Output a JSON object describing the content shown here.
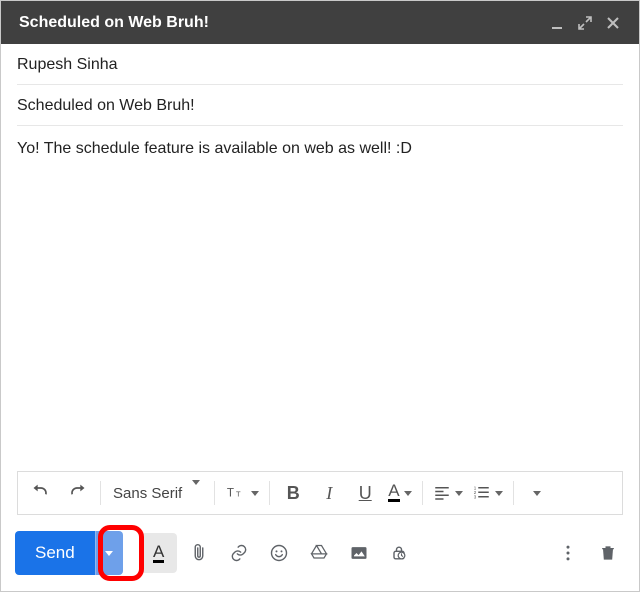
{
  "header": {
    "title": "Scheduled on Web Bruh!"
  },
  "recipients": "Rupesh Sinha",
  "subject": "Scheduled on Web Bruh!",
  "body": "Yo! The schedule feature is available on web as well! :D",
  "format_toolbar": {
    "font_family": "Sans Serif"
  },
  "actions": {
    "send_label": "Send"
  }
}
